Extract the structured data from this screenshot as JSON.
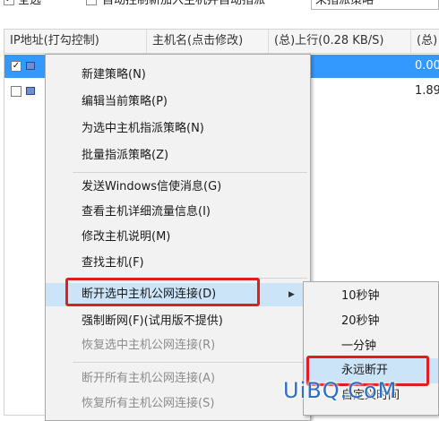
{
  "topbar": {
    "select_all_label": "全选",
    "auto_control_label": "自动控制新加入主机并自动指派",
    "policy_combo_value": "未指派策略"
  },
  "table": {
    "columns": [
      "IP地址(打勾控制)",
      "主机名(点击修改)",
      "(总)上行(0.28 KB/S)",
      "(总)"
    ],
    "rows": [
      {
        "checked": true,
        "selected": true,
        "value": "0.00"
      },
      {
        "checked": false,
        "selected": false,
        "value": "1.89"
      }
    ]
  },
  "context_menu": {
    "items": [
      {
        "label": "新建策略(N)",
        "enabled": true
      },
      {
        "label": "编辑当前策略(P)",
        "enabled": true
      },
      {
        "label": "为选中主机指派策略(N)",
        "enabled": true
      },
      {
        "label": "批量指派策略(Z)",
        "enabled": true
      },
      {
        "label": "发送Windows信使消息(G)",
        "enabled": true
      },
      {
        "label": "查看主机详细流量信息(I)",
        "enabled": true
      },
      {
        "label": "修改主机说明(M)",
        "enabled": true
      },
      {
        "label": "查找主机(F)",
        "enabled": true
      },
      {
        "label": "断开选中主机公网连接(D)",
        "enabled": true,
        "has_submenu": true,
        "highlighted": true
      },
      {
        "label": "强制断网(F)(试用版不提供)",
        "enabled": true
      },
      {
        "label": "恢复选中主机公网连接(R)",
        "enabled": false
      },
      {
        "label": "断开所有主机公网连接(A)",
        "enabled": false
      },
      {
        "label": "恢复所有主机公网连接(S)",
        "enabled": false
      }
    ],
    "submenu_arrow": "▶"
  },
  "submenu": {
    "items": [
      {
        "label": "10秒钟"
      },
      {
        "label": "20秒钟"
      },
      {
        "label": "一分钟"
      },
      {
        "label": "永远断开",
        "highlighted": true
      },
      {
        "label": "自定义时间"
      }
    ]
  },
  "watermark": {
    "text": "UiBQ.CoM"
  },
  "colors": {
    "selection": "#3399ff",
    "menu_bg": "#f2f2f2",
    "menu_hover": "#cce4f7",
    "annotation": "#e01e1e",
    "watermark": "#2a6fc9"
  }
}
